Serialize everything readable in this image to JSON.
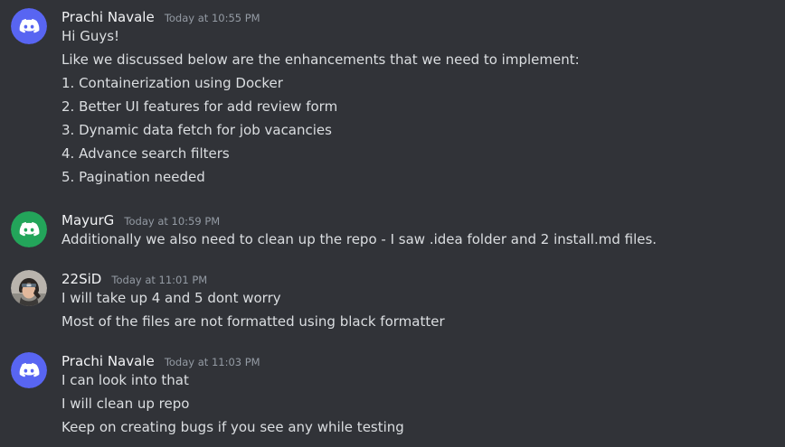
{
  "messages": [
    {
      "author": "Prachi Navale",
      "time": "Today at 10:55 PM",
      "avatar": "discord-icon",
      "avatar_color": "#5865f2",
      "lines": [
        "Hi Guys!",
        "Like we discussed below are the enhancements that we need to implement:",
        "1. Containerization using Docker",
        "2. Better UI features for add review form",
        "3. Dynamic data fetch for job vacancies",
        "4. Advance search filters",
        "5. Pagination needed"
      ]
    },
    {
      "author": "MayurG",
      "time": "Today at 10:59 PM",
      "avatar": "discord-icon",
      "avatar_color": "#23a55a",
      "lines": [
        "Additionally we also need to clean up the repo - I saw .idea folder and 2 install.md files."
      ]
    },
    {
      "author": "22SiD",
      "time": "Today at 11:01 PM",
      "avatar": "user-photo",
      "lines": [
        "I will take up 4 and 5 dont worry",
        "Most of the files are not formatted using black formatter"
      ]
    },
    {
      "author": "Prachi Navale",
      "time": "Today at 11:03 PM",
      "avatar": "discord-icon",
      "avatar_color": "#5865f2",
      "lines": [
        "I can look into that",
        "I will clean up repo",
        "Keep on creating bugs if you see any while testing"
      ]
    }
  ]
}
